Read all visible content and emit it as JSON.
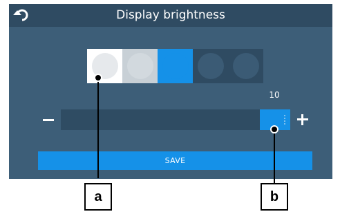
{
  "header": {
    "title": "Display brightness",
    "back_icon": "back-arrow-icon"
  },
  "brightness": {
    "levels": 5,
    "selected_level": 3,
    "level_colors": [
      "#e6e9ec",
      "#d2d9de",
      "#1591e8",
      "#3b5b75",
      "#3b5b75"
    ],
    "cell_colors": [
      "#ffffff",
      "#c8d0d6",
      "#1591e8",
      "#2f4b62",
      "#2f4b62"
    ],
    "slider_value": "10",
    "slider_fraction": 1.0,
    "minus_label": "−",
    "plus_label": "+"
  },
  "footer": {
    "save_label": "SAVE"
  },
  "callouts": {
    "a": "a",
    "b": "b"
  },
  "colors": {
    "screen_bg": "#3d5e78",
    "titlebar_bg": "#2f4b62",
    "accent": "#1591e8"
  }
}
